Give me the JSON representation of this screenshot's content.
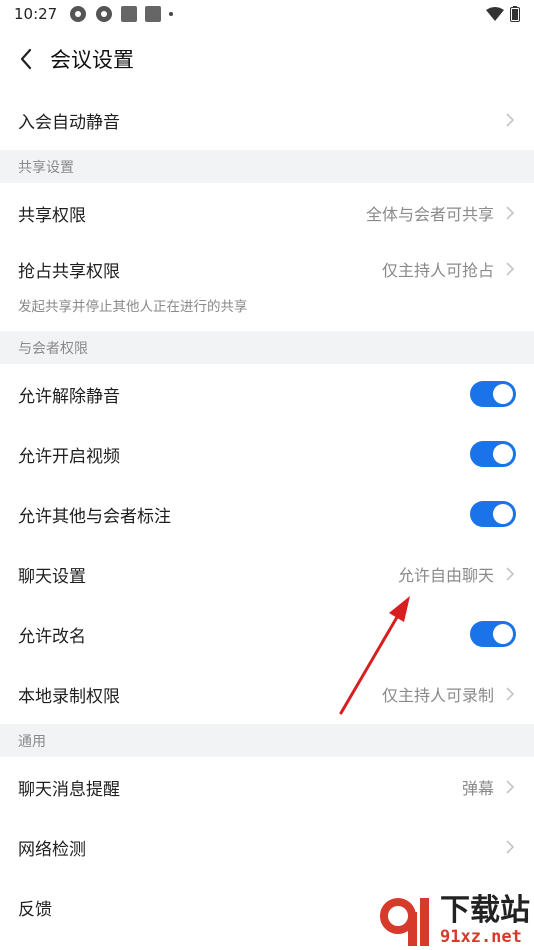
{
  "status_bar": {
    "time": "10:27"
  },
  "header": {
    "title": "会议设置"
  },
  "rows": {
    "auto_mute": {
      "label": "入会自动静音"
    },
    "share_permission": {
      "label": "共享权限",
      "value": "全体与会者可共享"
    },
    "grab_share": {
      "label": "抢占共享权限",
      "value": "仅主持人可抢占"
    },
    "grab_share_hint": "发起共享并停止其他人正在进行的共享",
    "allow_unmute": {
      "label": "允许解除静音",
      "on": true
    },
    "allow_video": {
      "label": "允许开启视频",
      "on": true
    },
    "allow_annotate": {
      "label": "允许其他与会者标注",
      "on": true
    },
    "chat_settings": {
      "label": "聊天设置",
      "value": "允许自由聊天"
    },
    "allow_rename": {
      "label": "允许改名",
      "on": true
    },
    "local_record": {
      "label": "本地录制权限",
      "value": "仅主持人可录制"
    },
    "chat_reminder": {
      "label": "聊天消息提醒",
      "value": "弹幕"
    },
    "network_check": {
      "label": "网络检测"
    },
    "feedback": {
      "label": "反馈"
    }
  },
  "sections": {
    "share": "共享设置",
    "participant": "与会者权限",
    "general": "通用"
  },
  "watermark": {
    "big": "下载站",
    "small": "91xz.net"
  },
  "colors": {
    "toggle_on": "#1a73e8",
    "section_bg": "#f2f3f5",
    "annotation_arrow": "#d81e1e"
  }
}
